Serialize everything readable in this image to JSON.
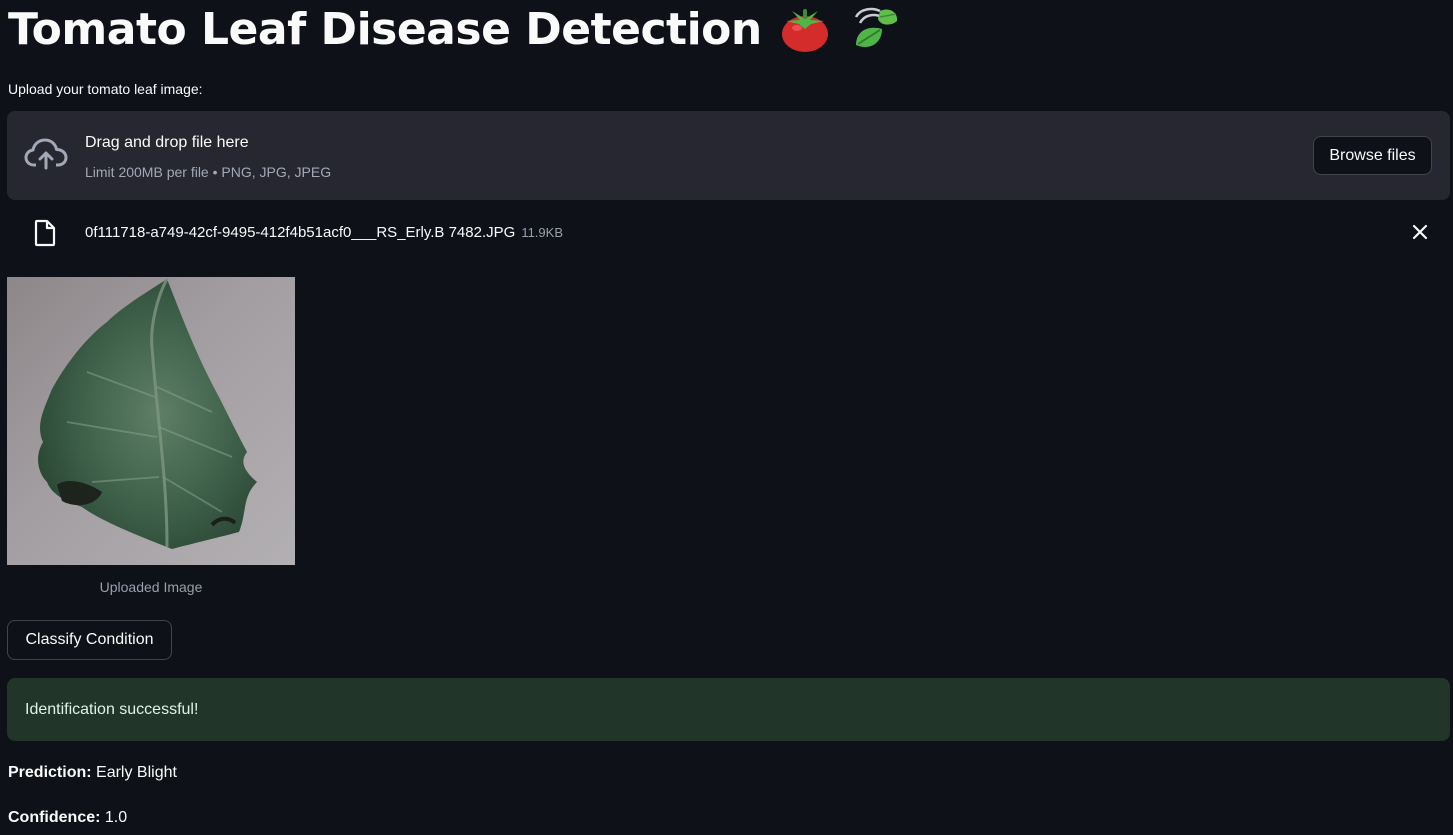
{
  "app": {
    "title": "Tomato Leaf Disease Detection",
    "title_emojis": [
      "tomato-emoji",
      "leaf-fluttering-in-wind-emoji"
    ]
  },
  "uploader": {
    "label": "Upload your tomato leaf image:",
    "dropzone_title": "Drag and drop file here",
    "dropzone_limit": "Limit 200MB per file • PNG, JPG, JPEG",
    "browse_label": "Browse files",
    "icon": "cloud-upload-icon"
  },
  "uploaded_file": {
    "name": "0f111718-a749-42cf-9495-412f4b51acf0___RS_Erly.B 7482.JPG",
    "size": "11.9KB",
    "icon": "file-icon",
    "remove_icon": "close-icon"
  },
  "preview": {
    "caption": "Uploaded Image"
  },
  "actions": {
    "classify_label": "Classify Condition"
  },
  "status": {
    "message": "Identification successful!",
    "color": "#213628"
  },
  "results": {
    "prediction_label": "Prediction:",
    "prediction_value": "Early Blight",
    "confidence_label": "Confidence:",
    "confidence_value": "1.0"
  },
  "colors": {
    "background": "#0e1117",
    "surface": "#262730",
    "text": "#fafafa",
    "muted": "#a3a8b8"
  }
}
